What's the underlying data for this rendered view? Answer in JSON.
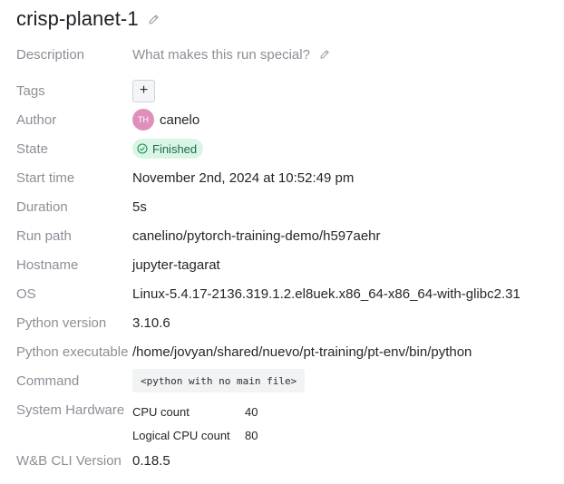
{
  "run": {
    "title": "crisp-planet-1"
  },
  "fields": {
    "description": {
      "label": "Description",
      "placeholder": "What makes this run special?"
    },
    "tags": {
      "label": "Tags",
      "add_label": "+"
    },
    "author": {
      "label": "Author",
      "initials": "TH",
      "name": "canelo"
    },
    "state": {
      "label": "State",
      "value": "Finished"
    },
    "start_time": {
      "label": "Start time",
      "value": "November 2nd, 2024 at 10:52:49 pm"
    },
    "duration": {
      "label": "Duration",
      "value": "5s"
    },
    "run_path": {
      "label": "Run path",
      "value": "canelino/pytorch-training-demo/h597aehr"
    },
    "hostname": {
      "label": "Hostname",
      "value": "jupyter-tagarat"
    },
    "os": {
      "label": "OS",
      "value": "Linux-5.4.17-2136.319.1.2.el8uek.x86_64-x86_64-with-glibc2.31"
    },
    "python_version": {
      "label": "Python version",
      "value": "3.10.6"
    },
    "python_executable": {
      "label": "Python executable",
      "value": "/home/jovyan/shared/nuevo/pt-training/pt-env/bin/python"
    },
    "command": {
      "label": "Command",
      "value": "<python with no main file>"
    },
    "system_hardware": {
      "label": "System Hardware",
      "rows": [
        {
          "key": "CPU count",
          "value": "40"
        },
        {
          "key": "Logical CPU count",
          "value": "80"
        }
      ]
    },
    "cli_version": {
      "label": "W&B CLI Version",
      "value": "0.18.5"
    }
  },
  "colors": {
    "label": "#8b8f96",
    "value": "#24262b",
    "state_badge_bg": "#d8f5e6",
    "state_badge_text": "#1f6b45",
    "avatar_bg": "#e08fbc"
  },
  "icons": {
    "title_edit": "pencil-icon",
    "description_edit": "pencil-icon",
    "state": "check-circle-icon"
  }
}
